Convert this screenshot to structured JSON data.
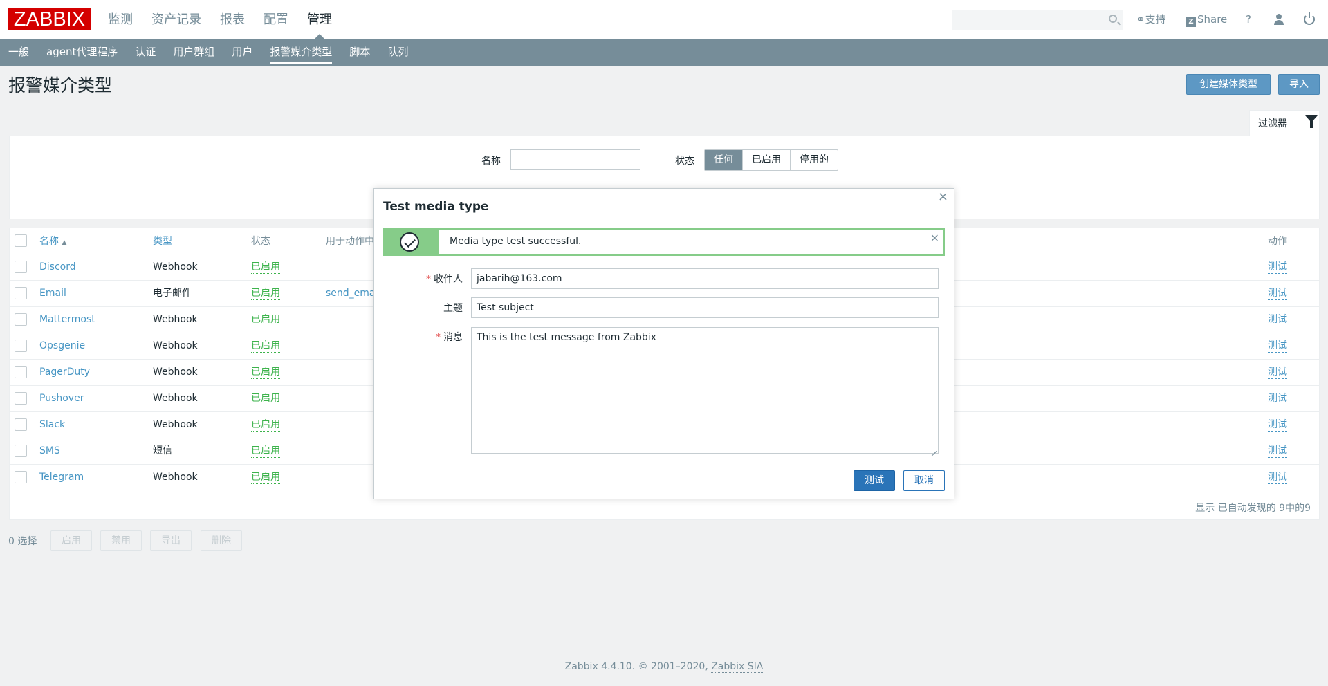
{
  "header": {
    "logo": "ZABBIX",
    "nav": [
      "监测",
      "资产记录",
      "报表",
      "配置",
      "管理"
    ],
    "active_nav": "管理",
    "search_placeholder": "",
    "support": "支持",
    "share": "Share",
    "help": "?"
  },
  "subnav": {
    "items": [
      "一般",
      "agent代理程序",
      "认证",
      "用户群组",
      "用户",
      "报警媒介类型",
      "脚本",
      "队列"
    ],
    "active": "报警媒介类型"
  },
  "page": {
    "title": "报警媒介类型",
    "create_button": "创建媒体类型",
    "import_button": "导入"
  },
  "filter": {
    "tab_label": "过滤器",
    "name_label": "名称",
    "name_value": "",
    "status_label": "状态",
    "status_options": [
      "任何",
      "已启用",
      "停用的"
    ],
    "status_selected": "任何"
  },
  "table": {
    "headers": {
      "name": "名称",
      "type": "类型",
      "status": "状态",
      "used_in": "用于动作中",
      "action": "动作"
    },
    "sort_indicator": "▲",
    "rows": [
      {
        "name": "Discord",
        "type": "Webhook",
        "status": "已启用",
        "used": "",
        "action": "测试"
      },
      {
        "name": "Email",
        "type": "电子邮件",
        "status": "已启用",
        "used": "send_ema",
        "action": "测试"
      },
      {
        "name": "Mattermost",
        "type": "Webhook",
        "status": "已启用",
        "used": "",
        "action": "测试"
      },
      {
        "name": "Opsgenie",
        "type": "Webhook",
        "status": "已启用",
        "used": "",
        "action": "测试"
      },
      {
        "name": "PagerDuty",
        "type": "Webhook",
        "status": "已启用",
        "used": "",
        "action": "测试"
      },
      {
        "name": "Pushover",
        "type": "Webhook",
        "status": "已启用",
        "used": "",
        "action": "测试"
      },
      {
        "name": "Slack",
        "type": "Webhook",
        "status": "已启用",
        "used": "",
        "action": "测试"
      },
      {
        "name": "SMS",
        "type": "短信",
        "status": "已启用",
        "used": "",
        "action": "测试"
      },
      {
        "name": "Telegram",
        "type": "Webhook",
        "status": "已启用",
        "used": "",
        "action": "测试"
      }
    ],
    "footer": "显示 已自动发现的 9中的9"
  },
  "actions_bar": {
    "selected": "0 选择",
    "buttons": [
      "启用",
      "禁用",
      "导出",
      "删除"
    ]
  },
  "footer": {
    "text": "Zabbix 4.4.10. © 2001–2020, ",
    "link": "Zabbix SIA"
  },
  "dialog": {
    "title": "Test media type",
    "close": "×",
    "message": "Media type test successful.",
    "message_close": "×",
    "sendto_label": "收件人",
    "sendto_value": "jabarih@163.com",
    "subject_label": "主题",
    "subject_value": "Test subject",
    "message_label": "消息",
    "message_value": "This is the test message from Zabbix",
    "test_button": "测试",
    "cancel_button": "取消"
  },
  "colors": {
    "accent": "#768d99",
    "link": "#4796c4",
    "enabled": "#3db34c",
    "logo": "#d40000",
    "success": "#86cc89",
    "primary_button": "#2a74b8"
  }
}
